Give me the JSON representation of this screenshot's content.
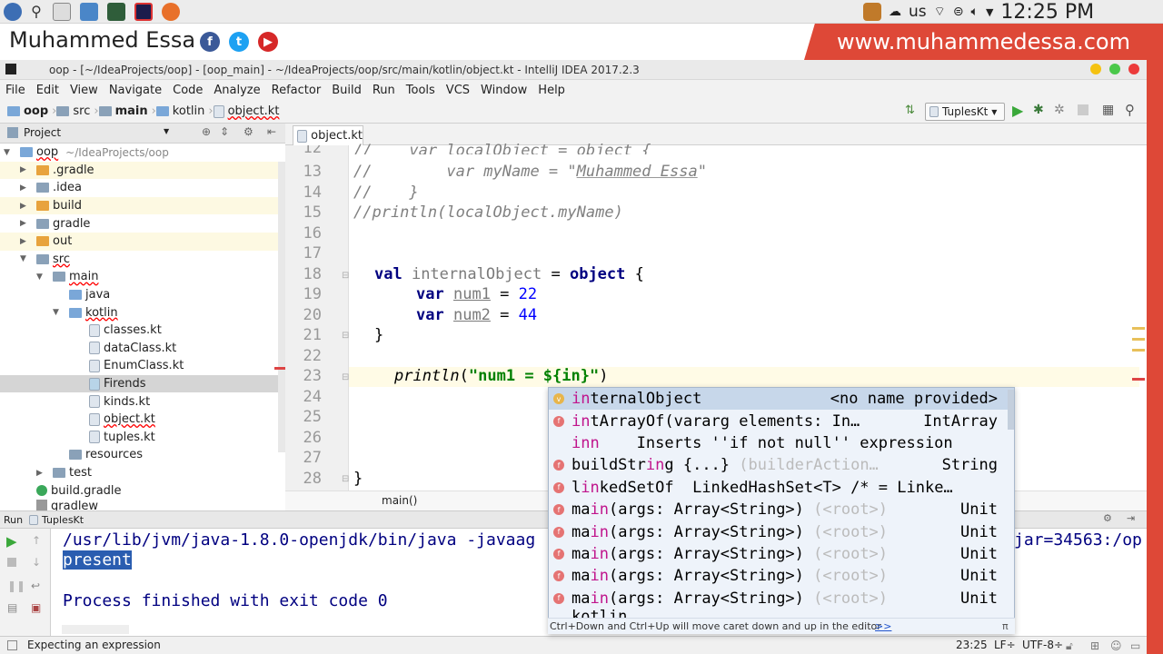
{
  "system": {
    "lang": "us",
    "time": "12:25 PM"
  },
  "banner": {
    "name": "Muhammed Essa",
    "website": "www.muhammedessa.com"
  },
  "window": {
    "title": "oop - [~/IdeaProjects/oop] - [oop_main] - ~/IdeaProjects/oop/src/main/kotlin/object.kt - IntelliJ IDEA 2017.2.3"
  },
  "menu": [
    "File",
    "Edit",
    "View",
    "Navigate",
    "Code",
    "Analyze",
    "Refactor",
    "Build",
    "Run",
    "Tools",
    "VCS",
    "Window",
    "Help"
  ],
  "navbar": {
    "crumbs": [
      "oop",
      "src",
      "main",
      "kotlin",
      "object.kt"
    ],
    "run_config": "TuplesKt"
  },
  "project": {
    "header": "Project",
    "items": [
      {
        "label": "oop",
        "extra": "~/IdeaProjects/oop"
      },
      {
        "label": ".gradle"
      },
      {
        "label": ".idea"
      },
      {
        "label": "build"
      },
      {
        "label": "gradle"
      },
      {
        "label": "out"
      },
      {
        "label": "src"
      },
      {
        "label": "main"
      },
      {
        "label": "java"
      },
      {
        "label": "kotlin"
      },
      {
        "label": "classes.kt"
      },
      {
        "label": "dataClass.kt"
      },
      {
        "label": "EnumClass.kt"
      },
      {
        "label": "Firends"
      },
      {
        "label": "kinds.kt"
      },
      {
        "label": "object.kt"
      },
      {
        "label": "tuples.kt"
      },
      {
        "label": "resources"
      },
      {
        "label": "test"
      },
      {
        "label": "build.gradle"
      },
      {
        "label": "gradlew"
      }
    ]
  },
  "editor": {
    "tab": "object.kt",
    "line_numbers": [
      "12",
      "13",
      "14",
      "15",
      "16",
      "17",
      "18",
      "19",
      "20",
      "21",
      "22",
      "23",
      "24",
      "25",
      "26",
      "27",
      "28"
    ],
    "code": {
      "l12": "//    var localObject = object {",
      "l13a": "//        var myName = \"",
      "l13b": "Muhammed Essa",
      "l13c": "\"",
      "l14": "//    }",
      "l15": "//println(localObject.myName)",
      "l18_kw": "val",
      "l18_name": " internalObject",
      "l18_eq": " = ",
      "l18_obj": "object",
      "l18_brace": " {",
      "l19_kw": "var",
      "l19_name": "num1",
      "l19_eq": " = ",
      "l19_val": "22",
      "l20_kw": "var",
      "l20_name": "num2",
      "l20_eq": " = ",
      "l20_val": "44",
      "l21": "}",
      "l23_fn": "println",
      "l23_p": "(",
      "l23_str": "\"num1 = ${in}\"",
      "l23_close": ")",
      "l28": "}"
    },
    "breadcrumb": "main()"
  },
  "completion": {
    "items": [
      {
        "hl": "in",
        "rest": "ternalObject",
        "tail": "",
        "type": "<no name provided>"
      },
      {
        "hl": "in",
        "rest": "tArrayOf(vararg elements: In…",
        "tail": "",
        "type": "IntArray"
      },
      {
        "hl": "inn",
        "rest": "    Inserts ''if not null'' expression",
        "tail": "",
        "type": ""
      },
      {
        "hl": "",
        "rest": "buildStr",
        "hl2": "in",
        "rest2": "g {...}",
        "tail": " (builderAction…",
        "type": "String"
      },
      {
        "hl": "",
        "rest": "l",
        "hl2": "in",
        "rest2": "kedSetOf  LinkedHashSet<T> /* = Linke…",
        "tail": "",
        "type": ""
      },
      {
        "hl": "",
        "rest": "ma",
        "hl2": "in",
        "rest2": "(args: Array<String>)",
        "tail": " (<root>)",
        "type": "Unit"
      },
      {
        "hl": "",
        "rest": "ma",
        "hl2": "in",
        "rest2": "(args: Array<String>)",
        "tail": " (<root>)",
        "type": "Unit"
      },
      {
        "hl": "",
        "rest": "ma",
        "hl2": "in",
        "rest2": "(args: Array<String>)",
        "tail": " (<root>)",
        "type": "Unit"
      },
      {
        "hl": "",
        "rest": "ma",
        "hl2": "in",
        "rest2": "(args: Array<String>)",
        "tail": " (<root>)",
        "type": "Unit"
      },
      {
        "hl": "",
        "rest": "ma",
        "hl2": "in",
        "rest2": "(args: Array<String>)",
        "tail": " (<root>)",
        "type": "Unit"
      }
    ],
    "partial_last": "kotlin",
    "footer": "Ctrl+Down and Ctrl+Up will move caret down and up in the editor",
    "footer_link": ">>",
    "pi": "π"
  },
  "run": {
    "label": "Run",
    "config": "TuplesKt",
    "lines": [
      "/usr/lib/jvm/java-1.8.0-openjdk/bin/java -javaag",
      "present",
      "",
      "Process finished with exit code 0"
    ],
    "right_fragment": "jar=34563:/op"
  },
  "status": {
    "message": "Expecting an expression",
    "position": "23:25",
    "line_sep": "LF÷",
    "encoding": "UTF-8÷"
  }
}
